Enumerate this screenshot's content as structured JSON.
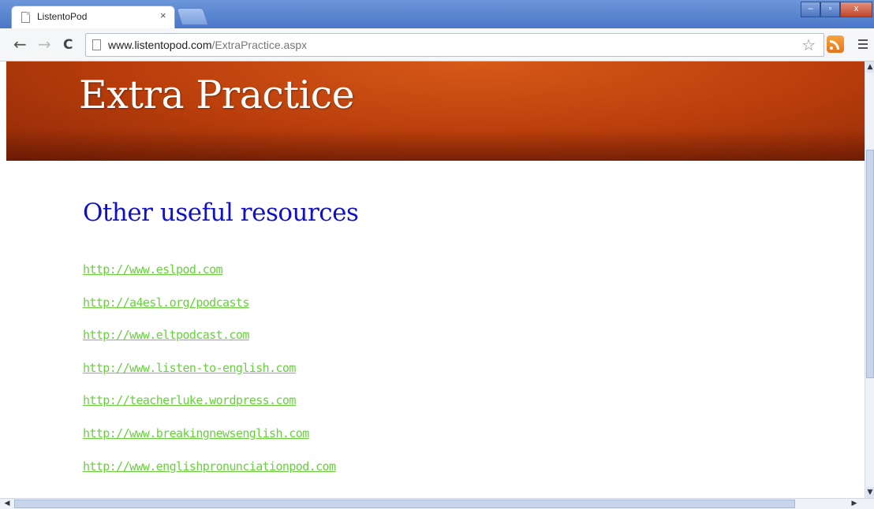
{
  "browser": {
    "tab": {
      "title": "ListentoPod",
      "close_glyph": "×"
    },
    "window_controls": {
      "minimize": "–",
      "maximize": "▫",
      "close": "x"
    },
    "nav": {
      "back": "←",
      "forward": "→",
      "reload": "C"
    },
    "address": {
      "domain": "www.listentopod.com",
      "path": "/ExtraPractice.aspx"
    },
    "star_glyph": "☆",
    "icons": [
      "page-icon",
      "back-arrow-icon",
      "forward-arrow-icon",
      "reload-icon",
      "star-icon",
      "rss-icon",
      "menu-icon"
    ]
  },
  "page": {
    "banner_title": "Extra Practice",
    "banner_colors": {
      "light": "#d75a18",
      "dark": "#8e2807"
    },
    "section_title": "Other useful resources",
    "links": [
      "http://www.eslpod.com",
      "http://a4esl.org/podcasts",
      "http://www.eltpodcast.com",
      "http://www.listen-to-english.com",
      "http://teacherluke.wordpress.com",
      "http://www.breakingnewsenglish.com",
      "http://www.englishpronunciationpod.com"
    ],
    "colors": {
      "section_title": "#1010c8",
      "link": "#66d23a"
    }
  },
  "scrollbars": {
    "up": "▲",
    "down": "▼",
    "left": "◀",
    "right": "▶"
  }
}
